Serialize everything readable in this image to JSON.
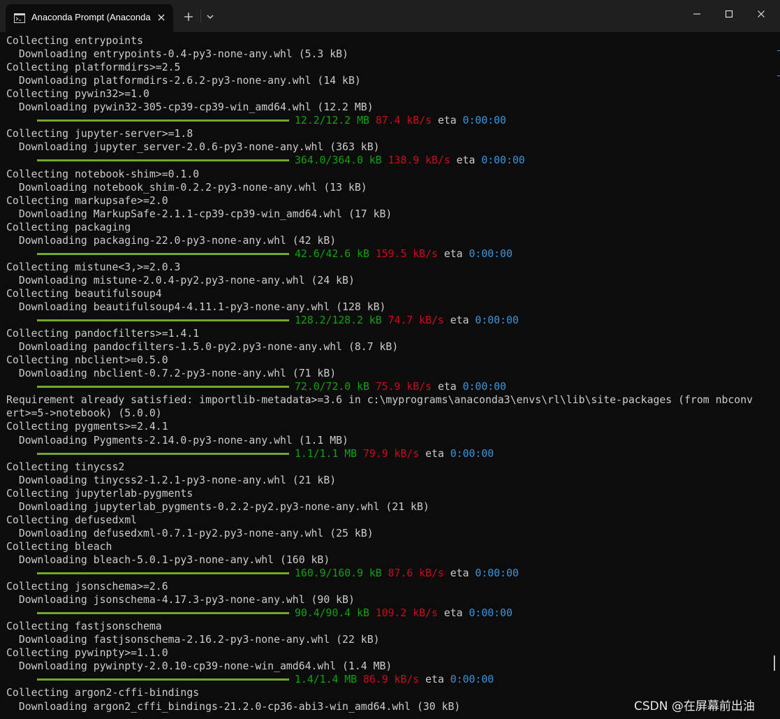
{
  "window": {
    "tab_title": "Anaconda Prompt (Anaconda",
    "tab_icon": "console-icon",
    "controls": [
      "minimize-icon",
      "maximize-icon",
      "close-icon"
    ]
  },
  "colors": {
    "background": "#0c0c0c",
    "text": "#cccccc",
    "progress_bar": "#72a82e",
    "size": "#13a10e",
    "speed": "#c50f1f",
    "eta": "#3a96dd"
  },
  "terminal": {
    "lines": [
      {
        "type": "text",
        "text": "Collecting entrypoints"
      },
      {
        "type": "text",
        "text": "  Downloading entrypoints-0.4-py3-none-any.whl (5.3 kB)"
      },
      {
        "type": "text",
        "text": "Collecting platformdirs>=2.5"
      },
      {
        "type": "text",
        "text": "  Downloading platformdirs-2.6.2-py3-none-any.whl (14 kB)"
      },
      {
        "type": "text",
        "text": "Collecting pywin32>=1.0"
      },
      {
        "type": "text",
        "text": "  Downloading pywin32-305-cp39-cp39-win_amd64.whl (12.2 MB)"
      },
      {
        "type": "progress",
        "size": "12.2/12.2 MB",
        "speed": "87.4 kB/s",
        "eta_label": "eta",
        "eta": "0:00:00"
      },
      {
        "type": "text",
        "text": "Collecting jupyter-server>=1.8"
      },
      {
        "type": "text",
        "text": "  Downloading jupyter_server-2.0.6-py3-none-any.whl (363 kB)"
      },
      {
        "type": "progress",
        "size": "364.0/364.0 kB",
        "speed": "138.9 kB/s",
        "eta_label": "eta",
        "eta": "0:00:00"
      },
      {
        "type": "text",
        "text": "Collecting notebook-shim>=0.1.0"
      },
      {
        "type": "text",
        "text": "  Downloading notebook_shim-0.2.2-py3-none-any.whl (13 kB)"
      },
      {
        "type": "text",
        "text": "Collecting markupsafe>=2.0"
      },
      {
        "type": "text",
        "text": "  Downloading MarkupSafe-2.1.1-cp39-cp39-win_amd64.whl (17 kB)"
      },
      {
        "type": "text",
        "text": "Collecting packaging"
      },
      {
        "type": "text",
        "text": "  Downloading packaging-22.0-py3-none-any.whl (42 kB)"
      },
      {
        "type": "progress",
        "size": "42.6/42.6 kB",
        "speed": "159.5 kB/s",
        "eta_label": "eta",
        "eta": "0:00:00"
      },
      {
        "type": "text",
        "text": "Collecting mistune<3,>=2.0.3"
      },
      {
        "type": "text",
        "text": "  Downloading mistune-2.0.4-py2.py3-none-any.whl (24 kB)"
      },
      {
        "type": "text",
        "text": "Collecting beautifulsoup4"
      },
      {
        "type": "text",
        "text": "  Downloading beautifulsoup4-4.11.1-py3-none-any.whl (128 kB)"
      },
      {
        "type": "progress",
        "size": "128.2/128.2 kB",
        "speed": "74.7 kB/s",
        "eta_label": "eta",
        "eta": "0:00:00"
      },
      {
        "type": "text",
        "text": "Collecting pandocfilters>=1.4.1"
      },
      {
        "type": "text",
        "text": "  Downloading pandocfilters-1.5.0-py2.py3-none-any.whl (8.7 kB)"
      },
      {
        "type": "text",
        "text": "Collecting nbclient>=0.5.0"
      },
      {
        "type": "text",
        "text": "  Downloading nbclient-0.7.2-py3-none-any.whl (71 kB)"
      },
      {
        "type": "progress",
        "size": "72.0/72.0 kB",
        "speed": "75.9 kB/s",
        "eta_label": "eta",
        "eta": "0:00:00"
      },
      {
        "type": "text",
        "text": "Requirement already satisfied: importlib-metadata>=3.6 in c:\\myprograms\\anaconda3\\envs\\rl\\lib\\site-packages (from nbconv"
      },
      {
        "type": "text",
        "text": "ert>=5->notebook) (5.0.0)"
      },
      {
        "type": "text",
        "text": "Collecting pygments>=2.4.1"
      },
      {
        "type": "text",
        "text": "  Downloading Pygments-2.14.0-py3-none-any.whl (1.1 MB)"
      },
      {
        "type": "progress",
        "size": "1.1/1.1 MB",
        "speed": "79.9 kB/s",
        "eta_label": "eta",
        "eta": "0:00:00"
      },
      {
        "type": "text",
        "text": "Collecting tinycss2"
      },
      {
        "type": "text",
        "text": "  Downloading tinycss2-1.2.1-py3-none-any.whl (21 kB)"
      },
      {
        "type": "text",
        "text": "Collecting jupyterlab-pygments"
      },
      {
        "type": "text",
        "text": "  Downloading jupyterlab_pygments-0.2.2-py2.py3-none-any.whl (21 kB)"
      },
      {
        "type": "text",
        "text": "Collecting defusedxml"
      },
      {
        "type": "text",
        "text": "  Downloading defusedxml-0.7.1-py2.py3-none-any.whl (25 kB)"
      },
      {
        "type": "text",
        "text": "Collecting bleach"
      },
      {
        "type": "text",
        "text": "  Downloading bleach-5.0.1-py3-none-any.whl (160 kB)"
      },
      {
        "type": "progress",
        "size": "160.9/160.9 kB",
        "speed": "87.6 kB/s",
        "eta_label": "eta",
        "eta": "0:00:00"
      },
      {
        "type": "text",
        "text": "Collecting jsonschema>=2.6"
      },
      {
        "type": "text",
        "text": "  Downloading jsonschema-4.17.3-py3-none-any.whl (90 kB)"
      },
      {
        "type": "progress",
        "size": "90.4/90.4 kB",
        "speed": "109.2 kB/s",
        "eta_label": "eta",
        "eta": "0:00:00"
      },
      {
        "type": "text",
        "text": "Collecting fastjsonschema"
      },
      {
        "type": "text",
        "text": "  Downloading fastjsonschema-2.16.2-py3-none-any.whl (22 kB)"
      },
      {
        "type": "text",
        "text": "Collecting pywinpty>=1.1.0"
      },
      {
        "type": "text",
        "text": "  Downloading pywinpty-2.0.10-cp39-none-win_amd64.whl (1.4 MB)"
      },
      {
        "type": "progress",
        "size": "1.4/1.4 MB",
        "speed": "86.9 kB/s",
        "eta_label": "eta",
        "eta": "0:00:00"
      },
      {
        "type": "text",
        "text": "Collecting argon2-cffi-bindings"
      },
      {
        "type": "text",
        "text": "  Downloading argon2_cffi_bindings-21.2.0-cp36-abi3-win_amd64.whl (30 kB)"
      }
    ]
  },
  "watermark": "CSDN @在屏幕前出油"
}
